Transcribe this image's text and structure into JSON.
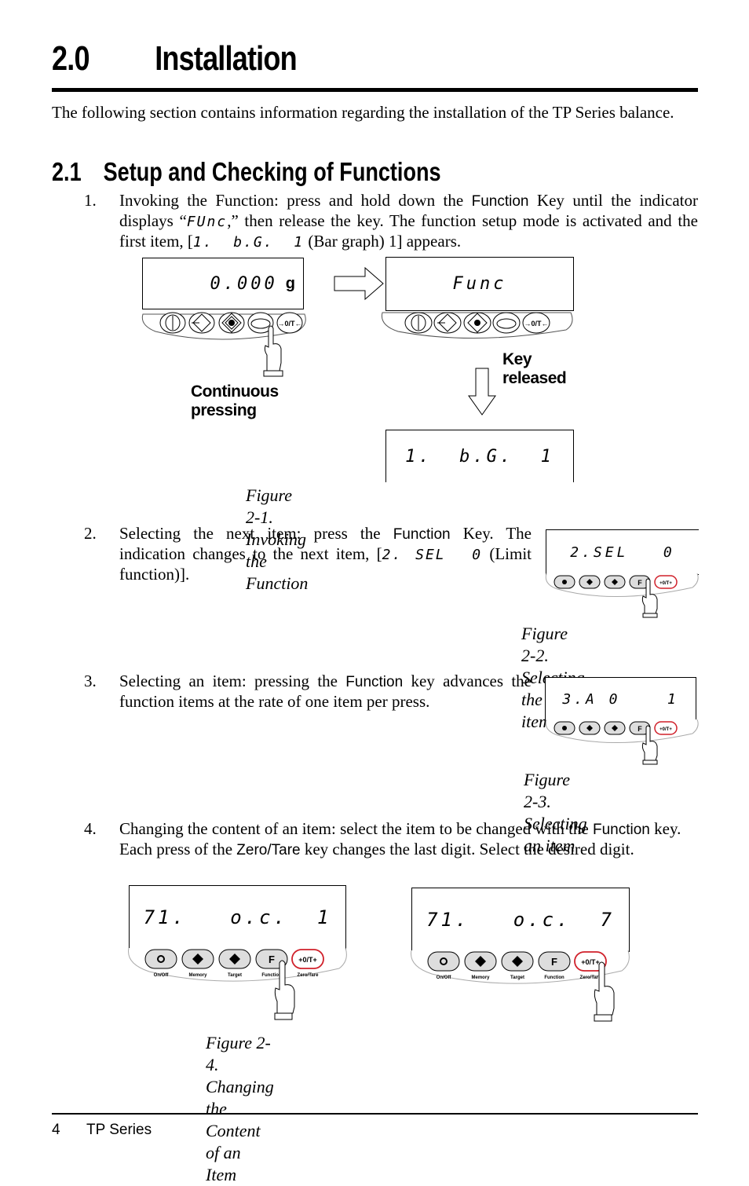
{
  "header": {
    "section_number": "2.0",
    "section_title": "Installation"
  },
  "intro": "The following section contains information regarding the installation of the TP Series balance.",
  "subsection": {
    "number": "2.1",
    "title": "Setup and Checking of Functions"
  },
  "steps": [
    {
      "num": "1.",
      "parts": {
        "a": "Invoking the Function: press and hold down the ",
        "key": "Function",
        "b": " Key until the indicator displays “",
        "lcd1": "FUnc",
        "c": ",” then release the key. The function setup mode is activated and the first item, [",
        "lcd2": "1.  b.G.  1",
        "d": " (Bar graph) 1] appears."
      }
    },
    {
      "num": "2.",
      "parts": {
        "a": "Selecting the next item: press the ",
        "key": "Function",
        "b": " Key. The indication changes to the next item, [",
        "lcd": "2. SEL  0",
        "c": " (Limit function)]."
      }
    },
    {
      "num": "3.",
      "parts": {
        "a": "Selecting an item: pressing the ",
        "key": "Function",
        "b": " key advances the function items at the rate of one item per press."
      }
    },
    {
      "num": "4.",
      "parts": {
        "a": "Changing the content of an item: select the item to be changed with the ",
        "key1": "Function",
        "b": " key. Each press of the ",
        "key2": "Zero/Tare",
        "c": " key changes the last digit. Select the desired digit."
      }
    }
  ],
  "figures": {
    "fig1": {
      "display_initial": "0.000",
      "unit": "g",
      "display_func": "Func",
      "display_result": "1.  b.G.  1",
      "label_pressing": "Continuous pressing",
      "label_released": "Key released",
      "zero_tare_key": "→0/T←",
      "caption": "Figure 2-1. Invoking the Function"
    },
    "fig2": {
      "display": "2.SEL   0",
      "caption_line1": "Figure 2-2. Selecting",
      "caption_line2": "the next item"
    },
    "fig3": {
      "display": "3.A 0    1",
      "caption_line1": "Figure 2-3. Selecting",
      "caption_line2": "an item"
    },
    "fig4": {
      "display_left": "71.   o.c.  1",
      "display_right": "71.   o.c.  7",
      "caption": "Figure 2-4. Changing the Content of an Item"
    },
    "keypad": {
      "key_labels": [
        "On/Off",
        "Memory",
        "Target",
        "Function",
        "Zero/Tare"
      ],
      "f_key": "F",
      "zero_tare_key": "→0/T←",
      "accent_color": "#d0202a"
    }
  },
  "footer": {
    "page_number": "4",
    "title": "TP Series"
  }
}
